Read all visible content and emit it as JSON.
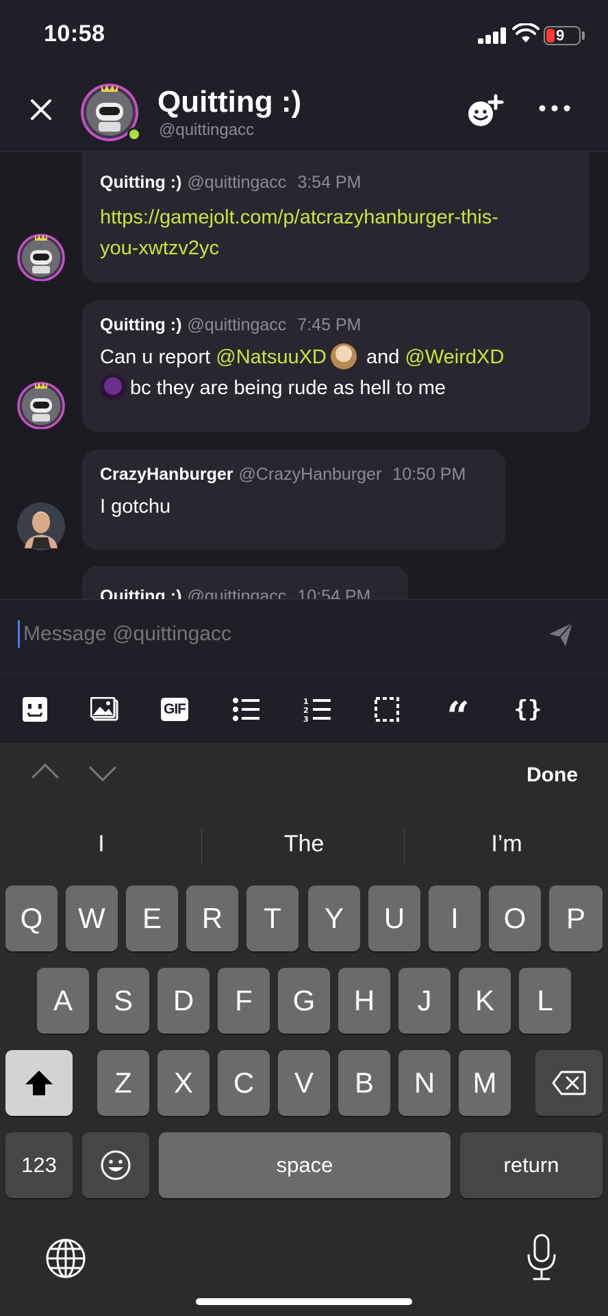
{
  "status_bar": {
    "time": "10:58",
    "battery": "9"
  },
  "header": {
    "title": "Quitting :)",
    "handle": "@quittingacc"
  },
  "messages": [
    {
      "name": "Quitting :)",
      "handle": "@quittingacc",
      "time": "3:54 PM",
      "lines": [
        "https://gamejolt.com/p/atcrazyhanburger-this-",
        "you-xwtzv2yc"
      ]
    },
    {
      "name": "Quitting :)",
      "handle": "@quittingacc",
      "time": "7:45 PM",
      "prefix": "Can u report ",
      "mention1": "@NatsuuXD",
      "middle": " and ",
      "mention2": "@WeirdXD",
      "suffix": "bc they are being rude as hell to me"
    },
    {
      "name": "CrazyHanburger",
      "handle": "@CrazyHanburger",
      "time": "10:50 PM",
      "text": "I gotchu"
    },
    {
      "name": "Quitting :)",
      "handle": "@quittingacc",
      "time": "10:54 PM"
    }
  ],
  "composer": {
    "placeholder": "Message @quittingacc"
  },
  "toolbar_icons": [
    "emoji-icon",
    "image-icon",
    "gif-icon",
    "bullet-list-icon",
    "numbered-list-icon",
    "spoiler-icon",
    "quote-icon",
    "code-icon"
  ],
  "toolbar": {
    "gif": "GIF",
    "quote": "“",
    "code": "{}"
  },
  "keyboard": {
    "done": "Done",
    "suggestions": [
      "I",
      "The",
      "I’m"
    ],
    "row1": [
      "Q",
      "W",
      "E",
      "R",
      "T",
      "Y",
      "U",
      "I",
      "O",
      "P"
    ],
    "row2": [
      "A",
      "S",
      "D",
      "F",
      "G",
      "H",
      "J",
      "K",
      "L"
    ],
    "row3": [
      "Z",
      "X",
      "C",
      "V",
      "B",
      "N",
      "M"
    ],
    "numbers": "123",
    "space": "space",
    "return": "return"
  },
  "colors": {
    "accent": "#c6e83b",
    "background": "#1d1b22",
    "bubble": "#29262f",
    "online": "#a8e03a"
  }
}
